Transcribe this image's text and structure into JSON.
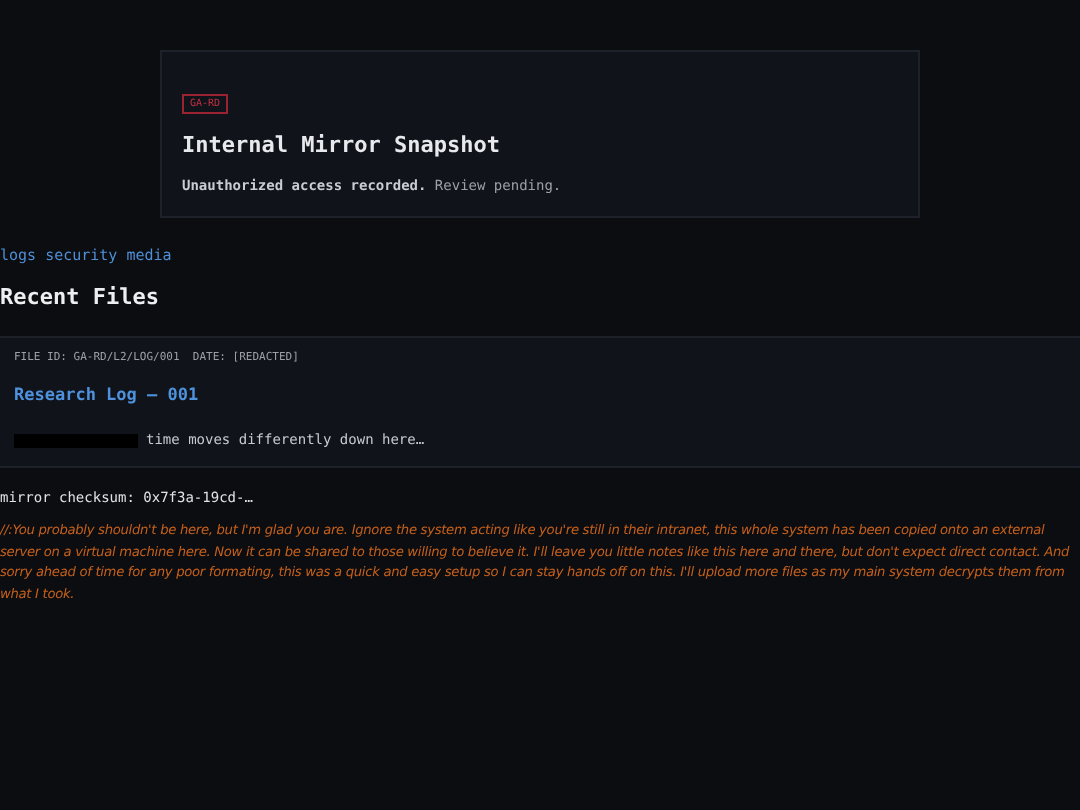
{
  "header": {
    "badge": "GA-RD",
    "title": "Internal Mirror Snapshot",
    "status_strong": "Unauthorized access recorded.",
    "status_rest": "Review pending."
  },
  "nav_links": [
    "logs",
    "security",
    "media"
  ],
  "section_title": "Recent Files",
  "files": [
    {
      "meta": "FILE ID: GA-RD/L2/LOG/001  DATE: [REDACTED]",
      "title": "Research Log — 001",
      "redacted": true,
      "excerpt": "time moves differently down here…"
    }
  ],
  "checksum": "mirror checksum: 0x7f3a-19cd-…",
  "note": "//:You probably shouldn't be here, but I'm glad you are. Ignore the system acting like you're still in their intranet, this whole system has been copied onto an external server on a virtual machine here. Now it can be shared to those willing to believe it. I'll leave you little notes like this here and there, but don't expect direct contact. And sorry ahead of time for any poor formating, this was a quick and easy setup so I can stay hands off on this. I'll upload more files as my main system decrypts them from what I took."
}
